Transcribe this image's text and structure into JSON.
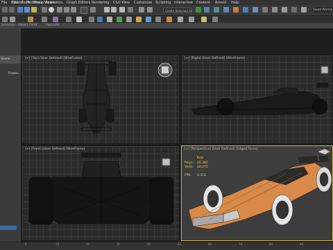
{
  "menu": [
    "File",
    "Edit",
    "Tools",
    "Group",
    "Views",
    "Create",
    "Modifiers",
    "Animation",
    "Graph Editors",
    "Rendering",
    "Civil View",
    "Customize",
    "Scripting",
    "Interactive",
    "Content",
    "Arnold",
    "Help"
  ],
  "toolbar": {
    "selection_set_placeholder": "Create Selection Se",
    "right_text": "Saved Worksp"
  },
  "ribbon": {
    "labels": [
      "Selection",
      "Object Paint",
      "Populate"
    ]
  },
  "left_panel": {
    "header": "Scene",
    "item": "Frozen"
  },
  "viewports": {
    "top": {
      "label": "[+] [Top] [User Defined] [Wireframe]"
    },
    "right": {
      "label": "[+] [Right] [User Defined] [Wireframe]"
    },
    "front": {
      "label": "[+] [Front] [User Defined] [Wireframe]"
    },
    "perspective": {
      "label": "[+] [Perspective] [User Defined] [Edged Faces]"
    }
  },
  "stats": {
    "total_label": "Total",
    "polys_label": "Polys:",
    "polys_value": "26,380",
    "verts_label": "Verts:",
    "verts_value": "20,275",
    "fps_label": "FPS:",
    "fps_value": "6.352"
  },
  "timeline": {
    "ticks": [
      "0",
      "10",
      "20",
      "30",
      "40",
      "50",
      "60",
      "70",
      "80",
      "90"
    ]
  },
  "colors": {
    "accent": "#d8b540",
    "car_orange": "#d98a48",
    "car_dark": "#2a2a2a",
    "panel_blue": "#3a6ea5"
  }
}
